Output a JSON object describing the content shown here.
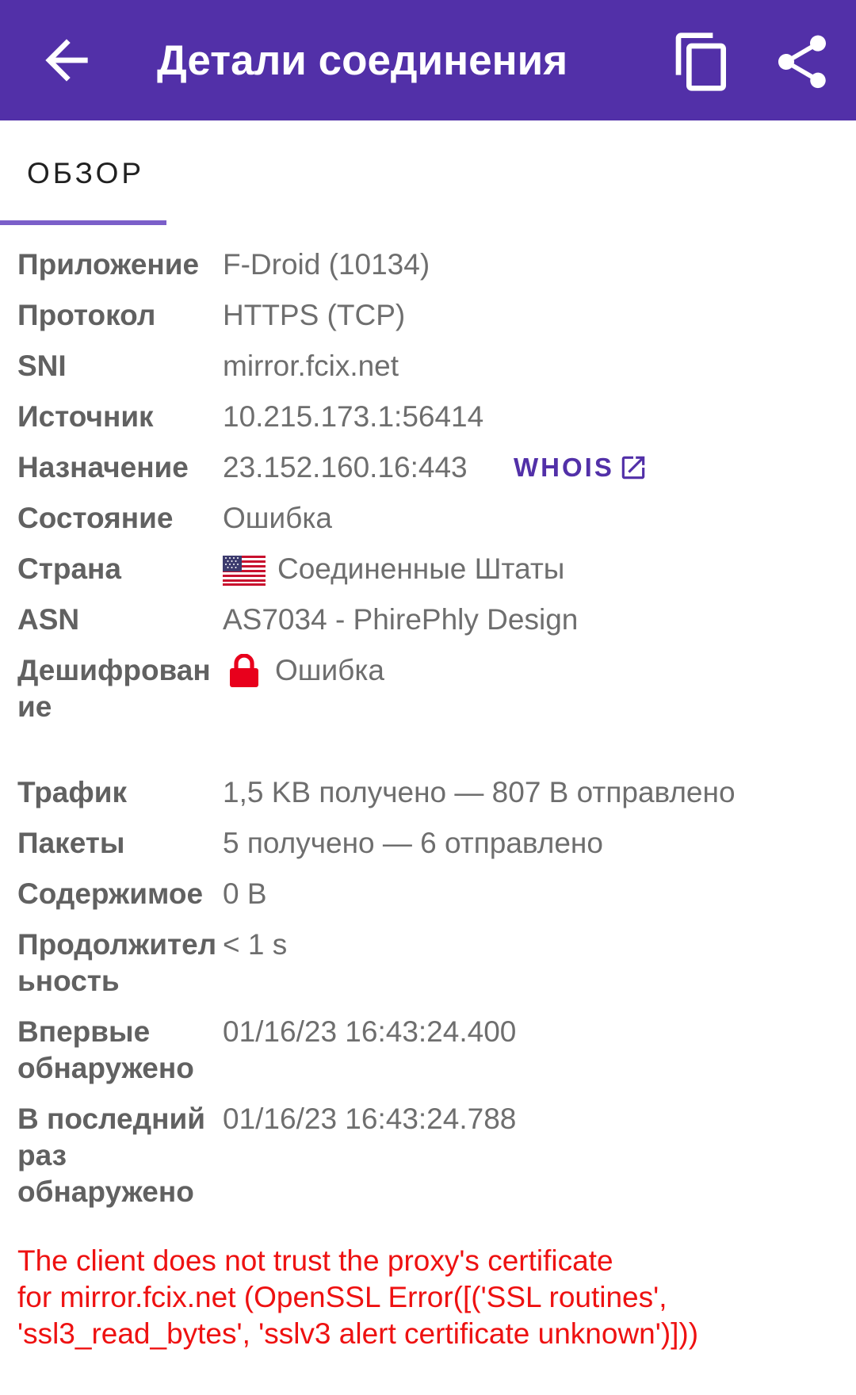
{
  "appbar": {
    "title": "Детали соединения",
    "back_icon": "arrow-back-icon",
    "copy_icon": "content-copy-icon",
    "share_icon": "share-icon"
  },
  "tabs": [
    {
      "label": "ОБЗОР",
      "selected": true
    }
  ],
  "details": {
    "app": {
      "label": "Приложение",
      "value": "F-Droid (10134)"
    },
    "protocol": {
      "label": "Протокол",
      "value": "HTTPS (TCP)"
    },
    "sni": {
      "label": "SNI",
      "value": "mirror.fcix.net"
    },
    "source": {
      "label": "Источник",
      "value": "10.215.173.1:56414"
    },
    "destination": {
      "label": "Назначение",
      "value": "23.152.160.16:443",
      "whois": "WHOIS"
    },
    "state": {
      "label": "Состояние",
      "value": "Ошибка"
    },
    "country": {
      "label": "Страна",
      "value": "Соединенные Штаты",
      "flag_icon": "us-flag-icon"
    },
    "asn": {
      "label": "ASN",
      "value": "AS7034 - PhirePhly Design"
    },
    "decryption": {
      "label": "Дешифрован ие",
      "label_line1": "Дешифрован",
      "label_line2": "ие",
      "value": "Ошибка",
      "lock_icon": "lock-icon",
      "lock_color": "#e8001c"
    },
    "traffic": {
      "label": "Трафик",
      "value": "1,5 KB получено — 807 B отправлено"
    },
    "packets": {
      "label": "Пакеты",
      "value": "5 получено — 6 отправлено"
    },
    "content": {
      "label": "Содержимое",
      "value": "0 B"
    },
    "duration": {
      "label": "Продолжительность",
      "label_line1": "Продолжител",
      "label_line2": "ьность",
      "value": "< 1 s"
    },
    "first_seen": {
      "label": "Впервые обнаружено",
      "label_line1": "Впервые",
      "label_line2": "обнаружено",
      "value": "01/16/23 16:43:24.400"
    },
    "last_seen": {
      "label": "В последний раз обнаружено",
      "label_line1": "В последний",
      "label_line2": "раз",
      "label_line3": "обнаружено",
      "value": "01/16/23 16:43:24.788"
    }
  },
  "error_message": {
    "line1": "The client does not trust the proxy's certificate",
    "line2": "for mirror.fcix.net (OpenSSL Error([('SSL routines',",
    "line3": "'ssl3_read_bytes', 'sslv3 alert certificate unknown')]))"
  },
  "colors": {
    "appbar": "#5230a8",
    "accent": "#5230a8",
    "tab_indicator": "#7b5fc9",
    "error": "#ee1111",
    "label": "#616161",
    "value": "#6e6e6e"
  }
}
